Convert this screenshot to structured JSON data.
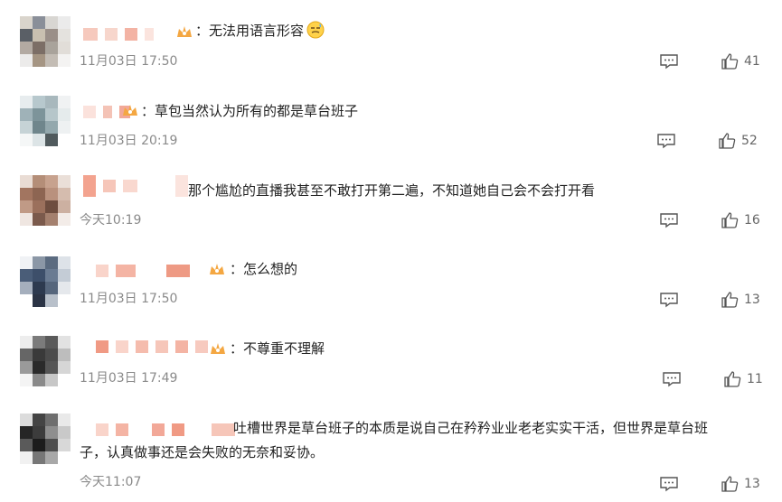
{
  "comments": [
    {
      "text": "：无法用语言形容",
      "time": "11月03日 17:50",
      "likes": "41",
      "emoji": "smiley-sweat-icon"
    },
    {
      "text": "：草包当然认为所有的都是草台班子",
      "time": "11月03日 20:19",
      "likes": "52"
    },
    {
      "text": "那个尴尬的直播我甚至不敢打开第二遍，不知道她自己会不会打开看",
      "time": "今天10:19",
      "likes": "16"
    },
    {
      "text": "：怎么想的",
      "time": "11月03日 17:50",
      "likes": "13"
    },
    {
      "text": "：不尊重不理解",
      "time": "11月03日 17:49",
      "likes": "11"
    },
    {
      "text_line1": "吐槽世界是草台班子的本质是说自己在矜矜业业老老实实干活，但世界是草台班",
      "text_line2": "子，认真做事还是会失败的无奈和妥协。",
      "time": "今天11:07",
      "likes": "13"
    }
  ],
  "icons": {
    "reply": "comment-icon",
    "like": "thumbs-up-icon",
    "badge": "crown-badge-icon"
  },
  "colors": {
    "text": "#222222",
    "meta": "#8a8a8a",
    "badge": "#f4a742",
    "mosaic_name": "#f2b7a6"
  }
}
